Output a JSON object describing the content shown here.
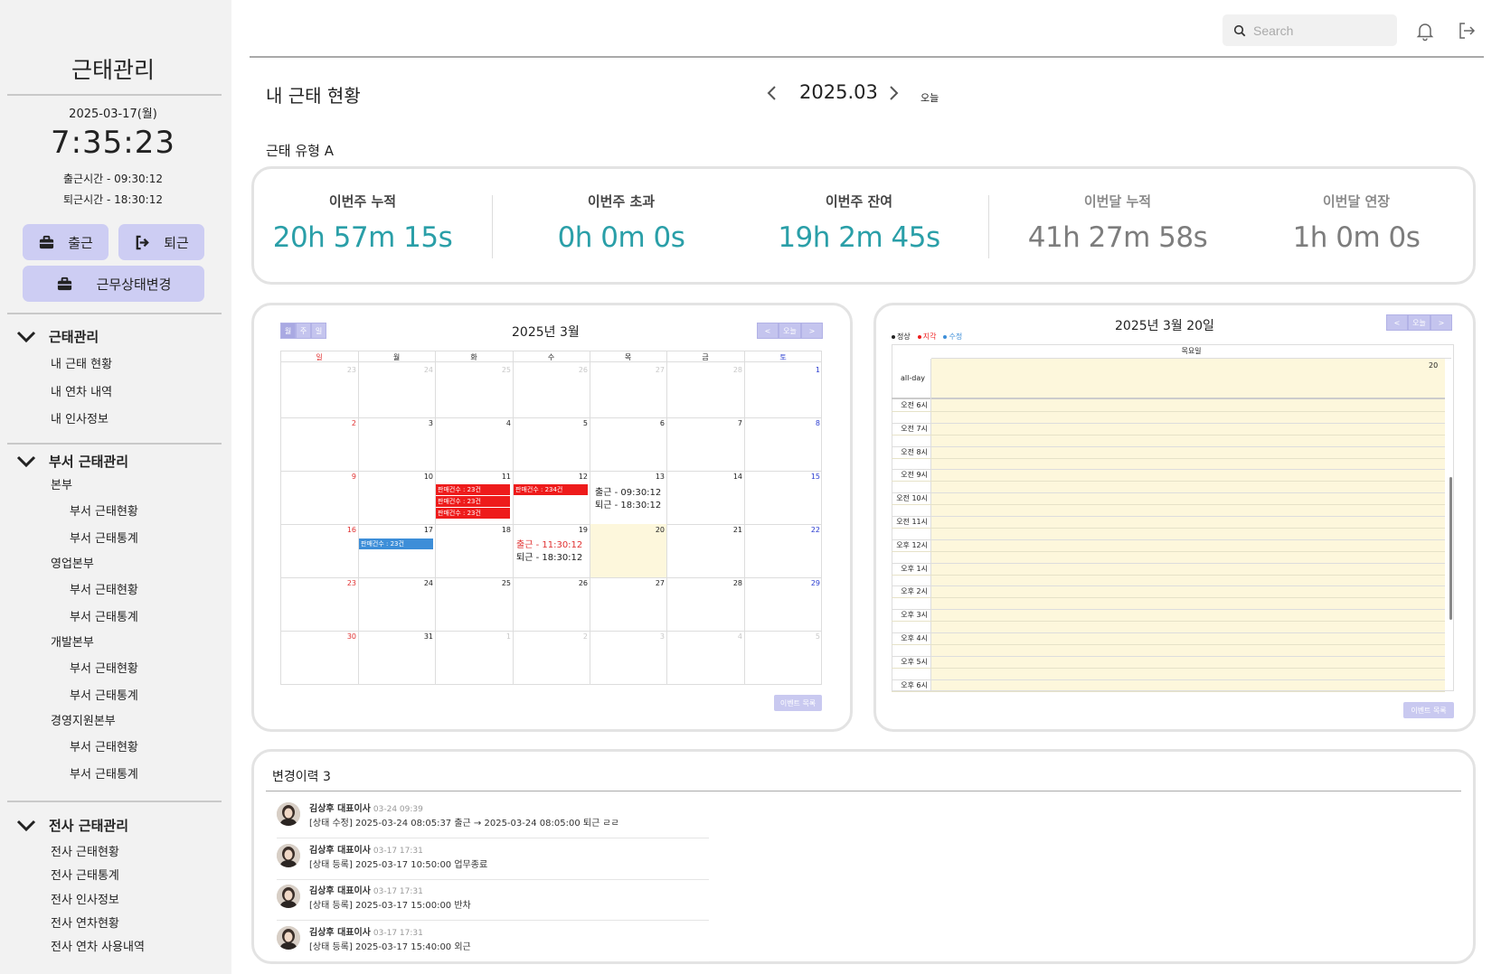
{
  "sidebar": {
    "title": "근태관리",
    "date": "2025-03-17(월)",
    "clock": "7:35:23",
    "checkin_time": "출근시간  -  09:30:12",
    "checkout_time": "퇴근시간  -  18:30:12",
    "btn_checkin": "출근",
    "btn_checkout": "퇴근",
    "btn_change": "근무상태변경",
    "groups": [
      {
        "label": "근태관리",
        "items": [
          "내 근태 현황",
          "내 연차 내역",
          "내 인사정보"
        ]
      },
      {
        "label": "부서 근태관리",
        "depts": [
          {
            "name": "본부",
            "items": [
              "부서 근태현황",
              "부서 근태통계"
            ]
          },
          {
            "name": "영업본부",
            "items": [
              "부서 근태현황",
              "부서 근태통계"
            ]
          },
          {
            "name": "개발본부",
            "items": [
              "부서 근태현황",
              "부서 근태통계"
            ]
          },
          {
            "name": "경영지원본부",
            "items": [
              "부서 근태현황",
              "부서 근태통계"
            ]
          }
        ]
      },
      {
        "label": "전사 근태관리",
        "items": [
          "전사 근태현황",
          "전사 근태통계",
          "전사 인사정보",
          "전사 연차현황",
          "전사 연차 사용내역"
        ]
      }
    ]
  },
  "topbar": {
    "search_placeholder": "Search"
  },
  "header": {
    "title": "내 근태 현황",
    "month": "2025.03",
    "today": "오늘",
    "type_label": "근태 유형 A"
  },
  "stats": [
    {
      "label": "이번주 누적",
      "value": "20h 57m 15s"
    },
    {
      "label": "이번주 초과",
      "value": "0h 0m 0s"
    },
    {
      "label": "이번주 잔여",
      "value": "19h 2m 45s"
    },
    {
      "label": "이번달 누적",
      "value": "41h 27m 58s"
    },
    {
      "label": "이번달 연장",
      "value": "1h 0m 0s"
    }
  ],
  "colors": {
    "accent": "#2a9fa8",
    "button": "#cdcdf3",
    "event_red": "#ee1b1b",
    "event_blue": "#3d8ed8",
    "highlight": "#fdf7dc"
  },
  "month_cal": {
    "title": "2025년 3월",
    "view_btns": [
      "월",
      "주",
      "일"
    ],
    "nav_btns": [
      "<",
      "오늘",
      ">"
    ],
    "dow": [
      "일",
      "월",
      "화",
      "수",
      "목",
      "금",
      "토"
    ],
    "weeks": [
      [
        "23",
        "24",
        "25",
        "26",
        "27",
        "28",
        "1"
      ],
      [
        "2",
        "3",
        "4",
        "5",
        "6",
        "7",
        "8"
      ],
      [
        "9",
        "10",
        "11",
        "12",
        "13",
        "14",
        "15"
      ],
      [
        "16",
        "17",
        "18",
        "19",
        "20",
        "21",
        "22"
      ],
      [
        "23",
        "24",
        "25",
        "26",
        "27",
        "28",
        "29"
      ],
      [
        "30",
        "31",
        "1",
        "2",
        "3",
        "4",
        "5"
      ]
    ],
    "events": {
      "e1": "판매건수 : 23건",
      "e2": "판매건수 : 23건",
      "e3": "판매건수 : 23건",
      "e4": "판매건수 : 234건",
      "e5": "판매건수 : 23건"
    },
    "d13_in": "출근 -  09:30:12",
    "d13_out": "퇴근 -  18:30:12",
    "d19_in": "출근 -  11:30:12",
    "d19_out": "퇴근 -  18:30:12",
    "event_list_btn": "이벤트 목록"
  },
  "day_cal": {
    "title": "2025년 3월 20일",
    "nav_btns": [
      "<",
      "오늘",
      ">"
    ],
    "legend": [
      {
        "label": "정상",
        "color": "#222222"
      },
      {
        "label": "지각",
        "color": "#ee1b1b"
      },
      {
        "label": "수정",
        "color": "#3d8ed8"
      }
    ],
    "weekday": "목요일",
    "day_num": "20",
    "allday": "all-day",
    "hours": [
      "오전 6시",
      "오전 7시",
      "오전 8시",
      "오전 9시",
      "오전 10시",
      "오전 11시",
      "오후 12시",
      "오후 1시",
      "오후 2시",
      "오후 3시",
      "오후 4시",
      "오후 5시",
      "오후 6시"
    ],
    "event_list_btn": "이벤트 목록"
  },
  "history": {
    "title": "변경이력 3",
    "rows": [
      {
        "who": "김상후 대표이사",
        "when": "03-24 09:39",
        "msg": "[상태 수정] 2025-03-24 08:05:37 출근 → 2025-03-24 08:05:00 퇴근 ㄹㄹ"
      },
      {
        "who": "김상후 대표이사",
        "when": "03-17 17:31",
        "msg": "[상태 등록] 2025-03-17 10:50:00 업무종료"
      },
      {
        "who": "김상후 대표이사",
        "when": "03-17 17:31",
        "msg": "[상태 등록] 2025-03-17 15:00:00 반차"
      },
      {
        "who": "김상후 대표이사",
        "when": "03-17 17:31",
        "msg": "[상태 등록] 2025-03-17 15:40:00 외근"
      }
    ]
  }
}
